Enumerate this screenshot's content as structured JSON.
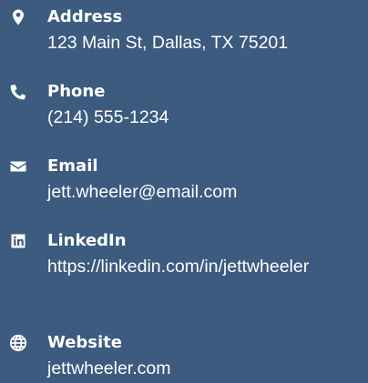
{
  "contact": {
    "items": [
      {
        "icon": "map-marker-icon",
        "label": "Address",
        "value": "123 Main St, Dallas, TX 75201"
      },
      {
        "icon": "phone-icon",
        "label": "Phone",
        "value": "(214) 555-1234"
      },
      {
        "icon": "envelope-icon",
        "label": "Email",
        "value": "jett.wheeler@email.com"
      },
      {
        "icon": "linkedin-icon",
        "label": "LinkedIn",
        "value": "https://linkedin.com/in/jettwheeler"
      },
      {
        "icon": "globe-icon",
        "label": "Website",
        "value": "jettwheeler.com"
      }
    ]
  },
  "colors": {
    "background": "#3c5b7e",
    "text": "#ffffff"
  }
}
